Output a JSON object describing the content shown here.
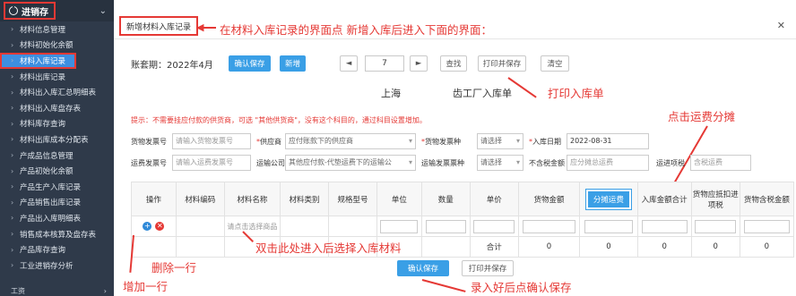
{
  "sidebar": {
    "header": "进销存",
    "items": [
      {
        "label": "材料信息管理"
      },
      {
        "label": "材料初始化余额"
      },
      {
        "label": "材料入库记录"
      },
      {
        "label": "材料出库记录"
      },
      {
        "label": "材料出入库汇总明细表"
      },
      {
        "label": "材料出入库盘存表"
      },
      {
        "label": "材料库存查询"
      },
      {
        "label": "材料出库成本分配表"
      },
      {
        "label": "产成品信息管理"
      },
      {
        "label": "产品初始化余额"
      },
      {
        "label": "产品生产入库记录"
      },
      {
        "label": "产品销售出库记录"
      },
      {
        "label": "产品出入库明细表"
      },
      {
        "label": "销售成本核算及盘存表"
      },
      {
        "label": "产品库存查询"
      },
      {
        "label": "工业进销存分析"
      }
    ],
    "footer": "工资"
  },
  "tab": {
    "title": "新增材料入库记录"
  },
  "annotations": {
    "a1": "在材料入库记录的界面点 新增入库后进入下面的界面：",
    "a2": "打印入库单",
    "a3": "点击运费分摊",
    "a4": "双击此处进入后选择入库材料",
    "a5": "增加一行",
    "a6": "删除一行",
    "a7": "录入好后点确认保存"
  },
  "toolbar": {
    "period": "账套期：2022年4月",
    "confirm_save": "确认保存",
    "add": "新增",
    "prev": "◄",
    "page": "7",
    "next": "►",
    "find": "查找",
    "print_save": "打印并保存",
    "clear": "清空"
  },
  "doc": {
    "city": "上海",
    "title": "齿工厂入库单"
  },
  "hint": "提示：不需要挂应付款的供货商，可选 \"其他供货商\"，没有这个科目的，通过科目设置增加。",
  "form": {
    "goods_invoice_no_label": "货物发票号",
    "goods_invoice_no_ph": "请输入货物发票号",
    "supplier_label": "供应商",
    "supplier_ph": "应付账款下的供应商",
    "goods_invoice_type_label": "货物发票种",
    "goods_invoice_type_val": "请选择",
    "in_date_label": "入库日期",
    "in_date_val": "2022-08-31",
    "freight_invoice_no_label": "运费发票号",
    "freight_invoice_no_ph": "请输入运费发票号",
    "transport_co_label": "运输公司",
    "transport_co_ph": "其他应付款-代垫运费下的运输公",
    "freight_invoice_type_label": "运输发票票种",
    "freight_invoice_type_val": "请选择",
    "no_tax_amount_label": "不含税金额",
    "no_tax_amount_ph": "应分摊总运费",
    "freight_tax_label": "运进项税",
    "freight_tax_ph": "含税运费"
  },
  "table": {
    "headers": [
      "操作",
      "材料编码",
      "材料名称",
      "材料类别",
      "规格型号",
      "单位",
      "数量",
      "单价",
      "货物金额",
      "分摊运费",
      "入库金额合计",
      "货物应抵扣进项税",
      "货物含税金额"
    ],
    "row_name_ph": "请点击选择商品",
    "total_label": "合计",
    "totals": [
      "0",
      "0",
      "0",
      "0",
      "0"
    ]
  },
  "bottom": {
    "confirm_save": "确认保存",
    "print_save": "打印并保存"
  },
  "colors": {
    "accent": "#3a9fe6",
    "annotation": "#e53935",
    "sidebar": "#2f3a4a"
  }
}
